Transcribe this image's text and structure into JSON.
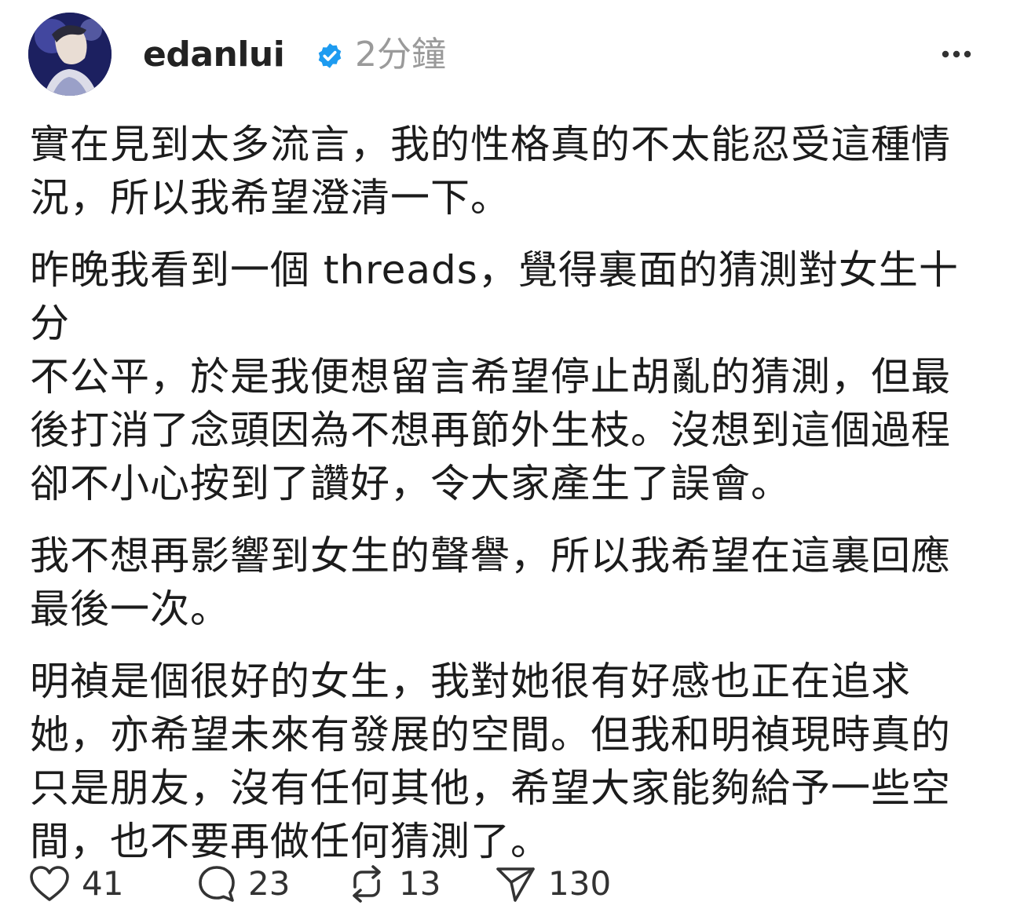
{
  "post": {
    "username": "edanlui",
    "timestamp": "2分鐘",
    "paragraphs": [
      "實在見到太多流言，我的性格真的不太能忍受這種情\n況，所以我希望澄清一下。",
      "昨晚我看到一個 threads，覺得裏面的猜測對女生十分\n不公平，於是我便想留言希望停止胡亂的猜測，但最\n後打消了念頭因為不想再節外生枝。沒想到這個過程\n卻不小心按到了讚好，令大家產生了誤會。",
      "我不想再影響到女生的聲譽，所以我希望在這裏回應\n最後一次。",
      "明禎是個很好的女生，我對她很有好感也正在追求\n她，亦希望未來有發展的空間。但我和明禎現時真的\n只是朋友，沒有任何其他，希望大家能夠給予一些空\n間，也不要再做任何猜測了。"
    ],
    "actions": {
      "likes": "41",
      "comments": "23",
      "reposts": "13",
      "shares": "130"
    }
  },
  "icons": {
    "verified": "verified-badge-icon",
    "more": "more-horizontal-icon",
    "like": "heart-icon",
    "comment": "speech-bubble-icon",
    "repost": "repost-icon",
    "share": "send-icon"
  },
  "colors": {
    "verified_blue": "#1d9bf0",
    "text": "#1c1c1c",
    "muted": "#9a9a9a"
  }
}
